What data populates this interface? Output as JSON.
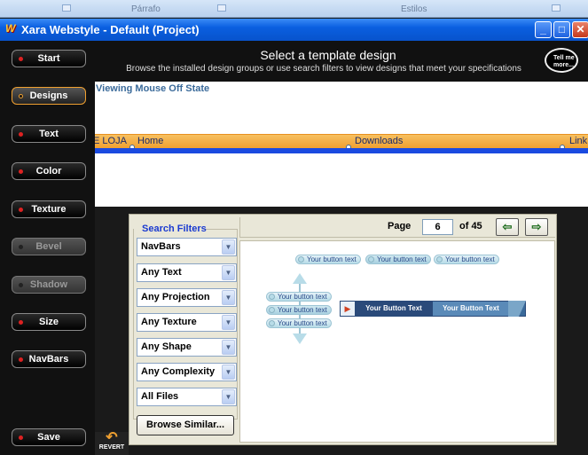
{
  "ribbon": {
    "left_label": "Párrafo",
    "right_label": "Estilos"
  },
  "window": {
    "title": "Xara Webstyle - Default (Project)",
    "logo": "W"
  },
  "sidebar": {
    "items": [
      {
        "label": "Start"
      },
      {
        "label": "Designs"
      },
      {
        "label": "Text"
      },
      {
        "label": "Color"
      },
      {
        "label": "Texture"
      },
      {
        "label": "Bevel"
      },
      {
        "label": "Shadow"
      },
      {
        "label": "Size"
      },
      {
        "label": "NavBars"
      },
      {
        "label": "Save"
      }
    ],
    "revert_label": "REVERT"
  },
  "header": {
    "title": "Select a template design",
    "subtitle": "Browse the installed design groups or use search filters to view designs that meet your specifications",
    "tell_me_label": "Tell me more..."
  },
  "preview": {
    "state_label": "Viewing Mouse Off State",
    "nav_items": [
      "E LOJA",
      "Home",
      "Downloads",
      "Link"
    ]
  },
  "filters": {
    "title": "Search Filters",
    "options": [
      "NavBars",
      "Any Text",
      "Any Projection",
      "Any Texture",
      "Any Shape",
      "Any Complexity",
      "All Files"
    ],
    "browse_similar_label": "Browse Similar..."
  },
  "pager": {
    "page_label": "Page",
    "page_value": "6",
    "of_label": "of 45"
  },
  "thumbnail": {
    "top_buttons": [
      "Your button text",
      "Your button text",
      "Your button text"
    ],
    "vertical_buttons": [
      "Your button text",
      "Your button text",
      "Your button text"
    ],
    "horizontal_buttons": [
      "Your Button Text",
      "Your Button Text"
    ]
  },
  "colors": {
    "title_bar": "#0a5fe0",
    "navbar_orange": "#f0a030",
    "accent_blue": "#1a4ae0"
  }
}
